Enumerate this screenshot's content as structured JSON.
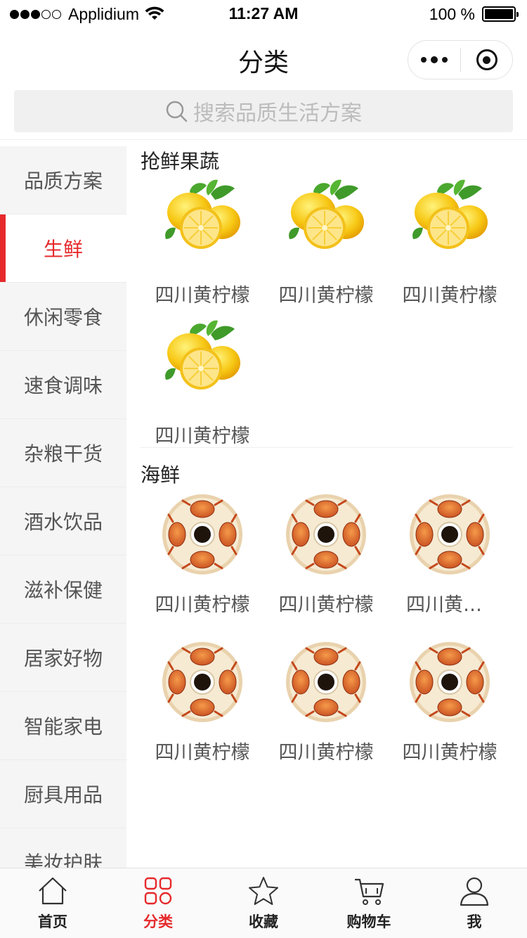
{
  "status_bar": {
    "carrier": "Applidium",
    "time": "11:27 AM",
    "battery": "100 %"
  },
  "nav": {
    "title": "分类"
  },
  "search": {
    "placeholder": "搜索品质生活方案"
  },
  "sidebar": {
    "active_index": 1,
    "items": [
      {
        "label": "品质方案"
      },
      {
        "label": "生鲜"
      },
      {
        "label": "休闲零食"
      },
      {
        "label": "速食调味"
      },
      {
        "label": "杂粮干货"
      },
      {
        "label": "酒水饮品"
      },
      {
        "label": "滋补保健"
      },
      {
        "label": "居家好物"
      },
      {
        "label": "智能家电"
      },
      {
        "label": "厨具用品"
      },
      {
        "label": "美妆护肤"
      }
    ]
  },
  "sections": [
    {
      "title": "抢鲜果蔬",
      "image_icon": "lemon-icon",
      "products": [
        {
          "name": "四川黄柠檬"
        },
        {
          "name": "四川黄柠檬"
        },
        {
          "name": "四川黄柠檬"
        },
        {
          "name": "四川黄柠檬"
        }
      ]
    },
    {
      "title": "海鲜",
      "image_icon": "crab-plate-icon",
      "products": [
        {
          "name": "四川黄柠檬"
        },
        {
          "name": "四川黄柠檬"
        },
        {
          "name": "四川黄柠檬"
        },
        {
          "name": "四川黄柠檬"
        },
        {
          "name": "四川黄柠檬"
        },
        {
          "name": "四川黄柠檬"
        }
      ]
    }
  ],
  "tab_bar": {
    "active_index": 1,
    "tabs": [
      {
        "label": "首页",
        "icon": "home-icon"
      },
      {
        "label": "分类",
        "icon": "category-grid-icon"
      },
      {
        "label": "收藏",
        "icon": "star-icon"
      },
      {
        "label": "购物车",
        "icon": "cart-icon"
      },
      {
        "label": "我",
        "icon": "user-icon"
      }
    ]
  },
  "colors": {
    "accent": "#e6292b",
    "sidebar_bg": "#f5f5f5",
    "search_bg": "#f0f0f0"
  }
}
